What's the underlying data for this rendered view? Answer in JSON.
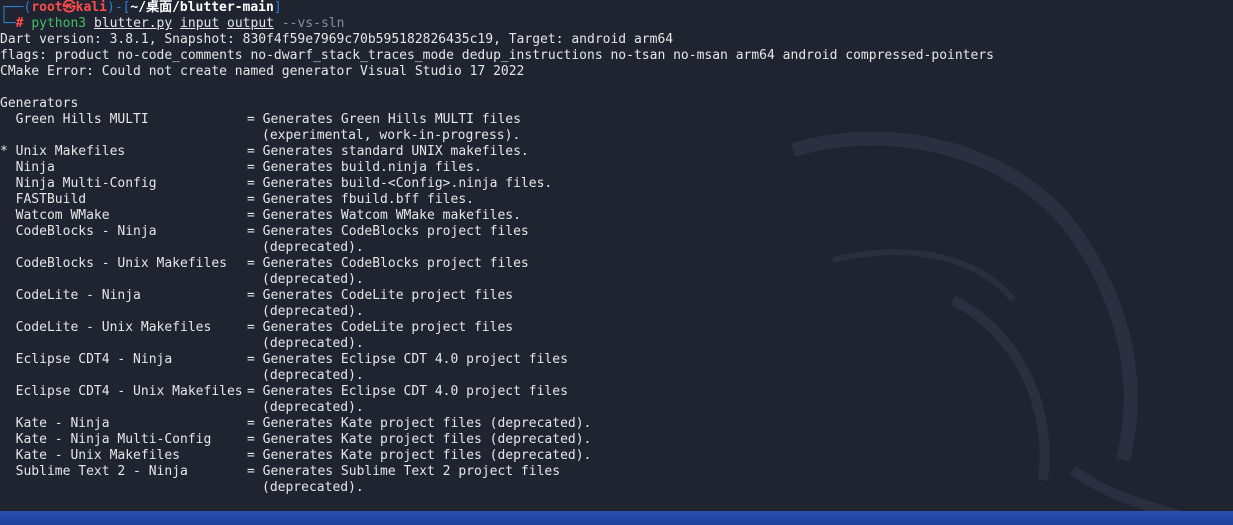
{
  "prompt": {
    "frame_top_left": "┌──(",
    "user": "root㉿kali",
    "frame_mid": ")-[",
    "path": "~/桌面/blutter-main",
    "frame_top_right": "]",
    "frame_bottom": "└─",
    "hash": "#",
    "command": "python3",
    "arg1": "blutter.py",
    "arg2": "input",
    "arg3": "output",
    "flag": "--vs-sln"
  },
  "output_lines": [
    "Dart version: 3.8.1, Snapshot: 830f4f59e7969c70b595182826435c19, Target: android arm64",
    "flags: product no-code_comments no-dwarf_stack_traces_mode dedup_instructions no-tsan no-msan arm64 android compressed-pointers",
    "CMake Error: Could not create named generator Visual Studio 17 2022",
    ""
  ],
  "generators_heading": "Generators",
  "generators": [
    {
      "name": "  Green Hills MULTI",
      "desc": "Generates Green Hills MULTI files",
      "cont": "(experimental, work-in-progress)."
    },
    {
      "name": "* Unix Makefiles",
      "desc": "Generates standard UNIX makefiles."
    },
    {
      "name": "  Ninja",
      "desc": "Generates build.ninja files."
    },
    {
      "name": "  Ninja Multi-Config",
      "desc": "Generates build-<Config>.ninja files."
    },
    {
      "name": "  FASTBuild",
      "desc": "Generates fbuild.bff files."
    },
    {
      "name": "  Watcom WMake",
      "desc": "Generates Watcom WMake makefiles."
    },
    {
      "name": "  CodeBlocks - Ninja",
      "desc": "Generates CodeBlocks project files",
      "cont": "(deprecated)."
    },
    {
      "name": "  CodeBlocks - Unix Makefiles",
      "desc": "Generates CodeBlocks project files",
      "cont": "(deprecated)."
    },
    {
      "name": "  CodeLite - Ninja",
      "desc": "Generates CodeLite project files",
      "cont": "(deprecated)."
    },
    {
      "name": "  CodeLite - Unix Makefiles",
      "desc": "Generates CodeLite project files",
      "cont": "(deprecated)."
    },
    {
      "name": "  Eclipse CDT4 - Ninja",
      "desc": "Generates Eclipse CDT 4.0 project files",
      "cont": "(deprecated)."
    },
    {
      "name": "  Eclipse CDT4 - Unix Makefiles",
      "desc": "Generates Eclipse CDT 4.0 project files",
      "cont": "(deprecated)."
    },
    {
      "name": "  Kate - Ninja",
      "desc": "Generates Kate project files (deprecated)."
    },
    {
      "name": "  Kate - Ninja Multi-Config",
      "desc": "Generates Kate project files (deprecated)."
    },
    {
      "name": "  Kate - Unix Makefiles",
      "desc": "Generates Kate project files (deprecated)."
    },
    {
      "name": "  Sublime Text 2 - Ninja",
      "desc": "Generates Sublime Text 2 project files",
      "cont": "(deprecated)."
    }
  ],
  "colors": {
    "background": "#1f2430",
    "prompt_frame": "#2f7fd6",
    "prompt_user": "#ff4d4d",
    "command": "#3fc060",
    "taskbar": "#2a4fb0"
  }
}
